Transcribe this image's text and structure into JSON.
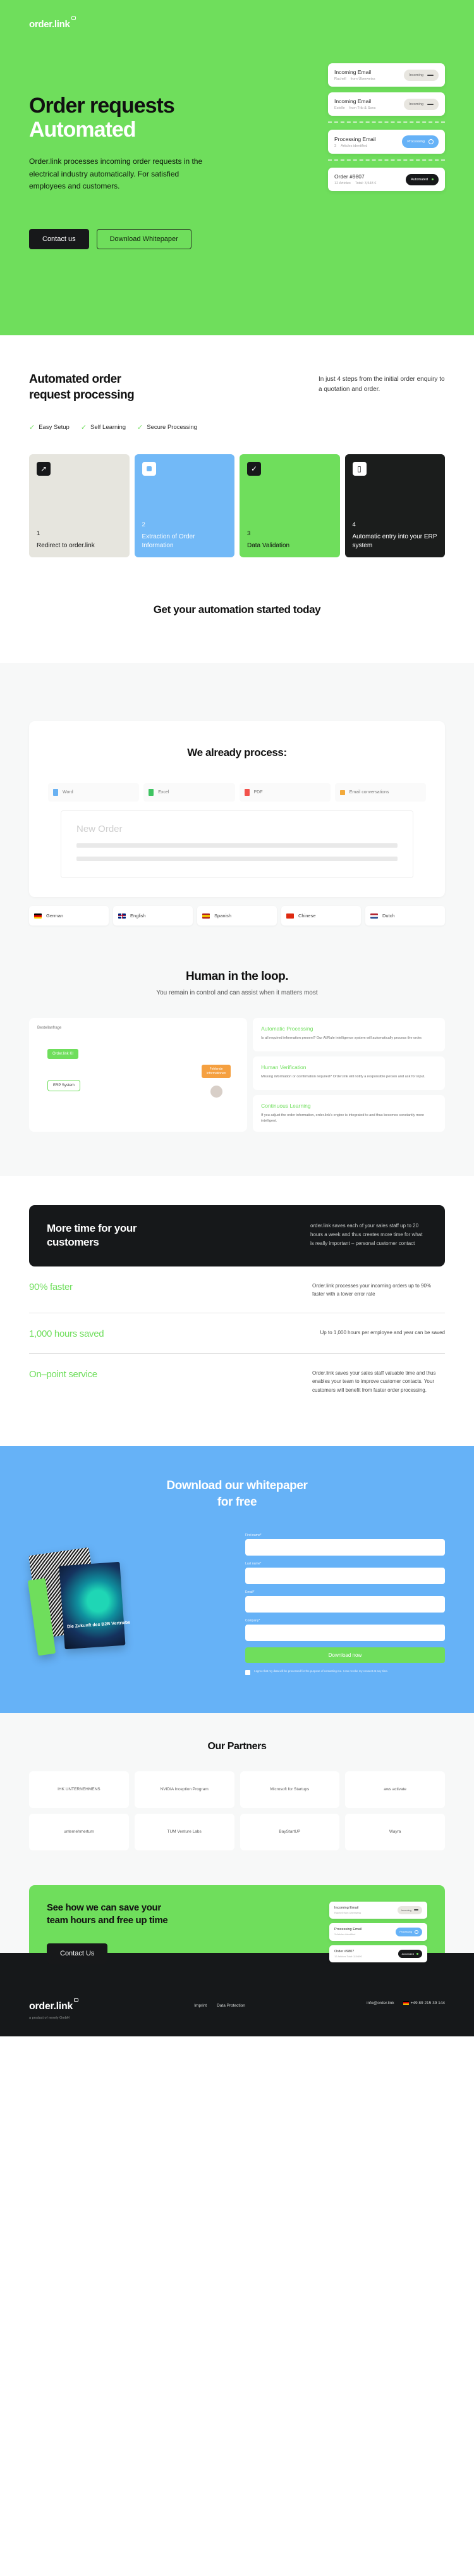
{
  "brand": {
    "logo": "order.link",
    "green": "#6FDE5C",
    "blue": "#66B2F7",
    "dark": "#16181A"
  },
  "hero": {
    "title_line1": "Order requests",
    "title_line2": "Automated",
    "subtitle": "Order.link processes incoming order requests in the electrical industry automatically. For satisfied employees and customers.",
    "primary_cta": "Contact us",
    "secondary_cta": "Download Whitepaper",
    "cards": [
      {
        "title": "Incoming Email",
        "meta1": "Rachell",
        "meta2": "from Überweiss",
        "badge": "Incoming",
        "style": "grey"
      },
      {
        "title": "Incoming Email",
        "meta1": "Estelle",
        "meta2": "from Trib & Sons",
        "badge": "Incoming",
        "style": "grey"
      },
      {
        "title": "Processing Email",
        "meta1": "3",
        "meta2": "Articles identified",
        "badge": "Processing",
        "style": "blue"
      },
      {
        "title": "Order #9807",
        "meta1": "12 Articles",
        "meta2": "Total: 3,548 €",
        "badge": "Automated",
        "style": "dark"
      }
    ]
  },
  "process": {
    "heading": "Automated order request processing",
    "intro": "In just 4 steps from the initial order enquiry to a quotation and order.",
    "checks": [
      "Easy Setup",
      "Self Learning",
      "Secure Processing"
    ],
    "steps": [
      {
        "num": "1",
        "label": "Redirect to order.link",
        "icon": "arrow-up-right-icon"
      },
      {
        "num": "2",
        "label": "Extraction of Order Information",
        "icon": "square-icon"
      },
      {
        "num": "3",
        "label": "Data Validation",
        "icon": "check-icon"
      },
      {
        "num": "4",
        "label": "Automatic entry into your ERP system",
        "icon": "device-icon"
      }
    ],
    "cta": "Get your automation started today"
  },
  "formats": {
    "heading": "We already process:",
    "types": [
      {
        "label": "Word",
        "color": "#69B1F2"
      },
      {
        "label": "Excel",
        "color": "#3FC462"
      },
      {
        "label": "PDF",
        "color": "#F2524B"
      },
      {
        "label": "Email conversations",
        "color": "#F2A93B"
      }
    ],
    "mock_title": "New Order",
    "languages": [
      {
        "label": "German",
        "flag": "de"
      },
      {
        "label": "English",
        "flag": "gb"
      },
      {
        "label": "Spanish",
        "flag": "es"
      },
      {
        "label": "Chinese",
        "flag": "cn"
      },
      {
        "label": "Dutch",
        "flag": "nl"
      }
    ]
  },
  "loop": {
    "heading": "Human in the loop.",
    "subheading": "You remain in control and can assist when it matters most",
    "diagram": {
      "title": "Bestellanfrage",
      "chip": "Order.link KI",
      "box": "ERP System",
      "orange": "Fehlende Informationen"
    },
    "features": [
      {
        "title": "Automatic Processing",
        "text": "Is all required information present? Our AI/Rule intelligence system will automatically process the order."
      },
      {
        "title": "Human Verification",
        "text": "Missing information or confirmation required? Order.link will notify a responsible person and ask for input."
      },
      {
        "title": "Continuous Learning",
        "text": "If you adjust the order information, order.link's engine is integrated to and thus becomes constantly more intelligent."
      }
    ]
  },
  "value": {
    "heading": "More time for your customers",
    "text": "order.link saves each of your sales staff up to 20 hours a week and thus creates more time for what is really important – personal customer contact",
    "stats": [
      {
        "title": "90% faster",
        "text": "Order.link processes your incoming orders up to 90% faster with a lower error rate"
      },
      {
        "title": "1,000 hours saved",
        "text": "Up to 1,000 hours per employee and year can be saved"
      },
      {
        "title": "On–point service",
        "text": "Order.link saves your sales staff valuable time and thus enables your team to improve customer contacts. Your customers will benefit from faster order processing."
      }
    ]
  },
  "whitepaper": {
    "heading_line1": "Download our whitepaper",
    "heading_line2": "for free",
    "book_title": "Die Zukunft des B2B Vertriebs",
    "fields": [
      {
        "label": "First name*",
        "value": ""
      },
      {
        "label": "Last name*",
        "value": ""
      },
      {
        "label": "Email*",
        "value": ""
      },
      {
        "label": "Company*",
        "value": ""
      }
    ],
    "submit": "Download now",
    "consent": "I agree that my data will be processed for the purpose of contacting me. I can revoke my consent at any time."
  },
  "partners": {
    "heading": "Our Partners",
    "row1": [
      "IHK UNTERNEHMENS",
      "NVIDIA Inception Program",
      "Microsoft for Startups",
      "aws activate"
    ],
    "row2": [
      "unternehmertum",
      "TUM Venture Labs",
      "BayStartUP",
      "Wayra"
    ]
  },
  "final_cta": {
    "heading": "See how we can save your team hours and free up time",
    "button": "Contact Us",
    "cards": [
      {
        "title": "Incoming Email",
        "meta": "Rachell from Überweiss",
        "badge": "Incoming",
        "style": "grey"
      },
      {
        "title": "Processing Email",
        "meta": "3 Articles identified",
        "badge": "Processing",
        "style": "blue"
      },
      {
        "title": "Order #9807",
        "meta": "12 Articles Total: 3,548 €",
        "badge": "Automated",
        "style": "dark"
      }
    ]
  },
  "footer": {
    "logo": "order.link",
    "tagline": "a product of nexely GmbH",
    "links": [
      "Imprint",
      "Data Protection"
    ],
    "email": "info@order.link",
    "phone": "+49 89 215 39 144"
  }
}
